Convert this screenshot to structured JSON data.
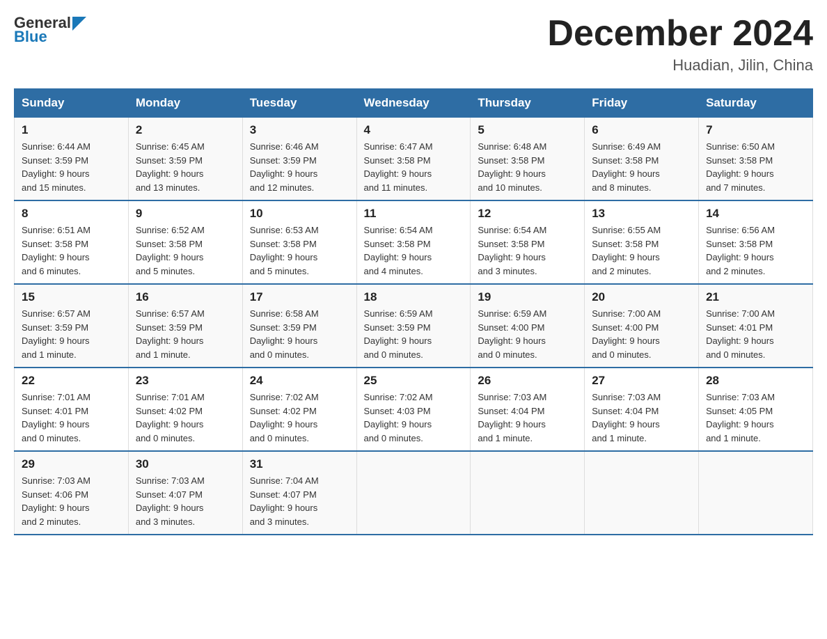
{
  "header": {
    "logo_general": "General",
    "logo_blue": "Blue",
    "title": "December 2024",
    "subtitle": "Huadian, Jilin, China"
  },
  "weekdays": [
    "Sunday",
    "Monday",
    "Tuesday",
    "Wednesday",
    "Thursday",
    "Friday",
    "Saturday"
  ],
  "weeks": [
    [
      {
        "day": "1",
        "info": "Sunrise: 6:44 AM\nSunset: 3:59 PM\nDaylight: 9 hours\nand 15 minutes."
      },
      {
        "day": "2",
        "info": "Sunrise: 6:45 AM\nSunset: 3:59 PM\nDaylight: 9 hours\nand 13 minutes."
      },
      {
        "day": "3",
        "info": "Sunrise: 6:46 AM\nSunset: 3:59 PM\nDaylight: 9 hours\nand 12 minutes."
      },
      {
        "day": "4",
        "info": "Sunrise: 6:47 AM\nSunset: 3:58 PM\nDaylight: 9 hours\nand 11 minutes."
      },
      {
        "day": "5",
        "info": "Sunrise: 6:48 AM\nSunset: 3:58 PM\nDaylight: 9 hours\nand 10 minutes."
      },
      {
        "day": "6",
        "info": "Sunrise: 6:49 AM\nSunset: 3:58 PM\nDaylight: 9 hours\nand 8 minutes."
      },
      {
        "day": "7",
        "info": "Sunrise: 6:50 AM\nSunset: 3:58 PM\nDaylight: 9 hours\nand 7 minutes."
      }
    ],
    [
      {
        "day": "8",
        "info": "Sunrise: 6:51 AM\nSunset: 3:58 PM\nDaylight: 9 hours\nand 6 minutes."
      },
      {
        "day": "9",
        "info": "Sunrise: 6:52 AM\nSunset: 3:58 PM\nDaylight: 9 hours\nand 5 minutes."
      },
      {
        "day": "10",
        "info": "Sunrise: 6:53 AM\nSunset: 3:58 PM\nDaylight: 9 hours\nand 5 minutes."
      },
      {
        "day": "11",
        "info": "Sunrise: 6:54 AM\nSunset: 3:58 PM\nDaylight: 9 hours\nand 4 minutes."
      },
      {
        "day": "12",
        "info": "Sunrise: 6:54 AM\nSunset: 3:58 PM\nDaylight: 9 hours\nand 3 minutes."
      },
      {
        "day": "13",
        "info": "Sunrise: 6:55 AM\nSunset: 3:58 PM\nDaylight: 9 hours\nand 2 minutes."
      },
      {
        "day": "14",
        "info": "Sunrise: 6:56 AM\nSunset: 3:58 PM\nDaylight: 9 hours\nand 2 minutes."
      }
    ],
    [
      {
        "day": "15",
        "info": "Sunrise: 6:57 AM\nSunset: 3:59 PM\nDaylight: 9 hours\nand 1 minute."
      },
      {
        "day": "16",
        "info": "Sunrise: 6:57 AM\nSunset: 3:59 PM\nDaylight: 9 hours\nand 1 minute."
      },
      {
        "day": "17",
        "info": "Sunrise: 6:58 AM\nSunset: 3:59 PM\nDaylight: 9 hours\nand 0 minutes."
      },
      {
        "day": "18",
        "info": "Sunrise: 6:59 AM\nSunset: 3:59 PM\nDaylight: 9 hours\nand 0 minutes."
      },
      {
        "day": "19",
        "info": "Sunrise: 6:59 AM\nSunset: 4:00 PM\nDaylight: 9 hours\nand 0 minutes."
      },
      {
        "day": "20",
        "info": "Sunrise: 7:00 AM\nSunset: 4:00 PM\nDaylight: 9 hours\nand 0 minutes."
      },
      {
        "day": "21",
        "info": "Sunrise: 7:00 AM\nSunset: 4:01 PM\nDaylight: 9 hours\nand 0 minutes."
      }
    ],
    [
      {
        "day": "22",
        "info": "Sunrise: 7:01 AM\nSunset: 4:01 PM\nDaylight: 9 hours\nand 0 minutes."
      },
      {
        "day": "23",
        "info": "Sunrise: 7:01 AM\nSunset: 4:02 PM\nDaylight: 9 hours\nand 0 minutes."
      },
      {
        "day": "24",
        "info": "Sunrise: 7:02 AM\nSunset: 4:02 PM\nDaylight: 9 hours\nand 0 minutes."
      },
      {
        "day": "25",
        "info": "Sunrise: 7:02 AM\nSunset: 4:03 PM\nDaylight: 9 hours\nand 0 minutes."
      },
      {
        "day": "26",
        "info": "Sunrise: 7:03 AM\nSunset: 4:04 PM\nDaylight: 9 hours\nand 1 minute."
      },
      {
        "day": "27",
        "info": "Sunrise: 7:03 AM\nSunset: 4:04 PM\nDaylight: 9 hours\nand 1 minute."
      },
      {
        "day": "28",
        "info": "Sunrise: 7:03 AM\nSunset: 4:05 PM\nDaylight: 9 hours\nand 1 minute."
      }
    ],
    [
      {
        "day": "29",
        "info": "Sunrise: 7:03 AM\nSunset: 4:06 PM\nDaylight: 9 hours\nand 2 minutes."
      },
      {
        "day": "30",
        "info": "Sunrise: 7:03 AM\nSunset: 4:07 PM\nDaylight: 9 hours\nand 3 minutes."
      },
      {
        "day": "31",
        "info": "Sunrise: 7:04 AM\nSunset: 4:07 PM\nDaylight: 9 hours\nand 3 minutes."
      },
      {
        "day": "",
        "info": ""
      },
      {
        "day": "",
        "info": ""
      },
      {
        "day": "",
        "info": ""
      },
      {
        "day": "",
        "info": ""
      }
    ]
  ]
}
